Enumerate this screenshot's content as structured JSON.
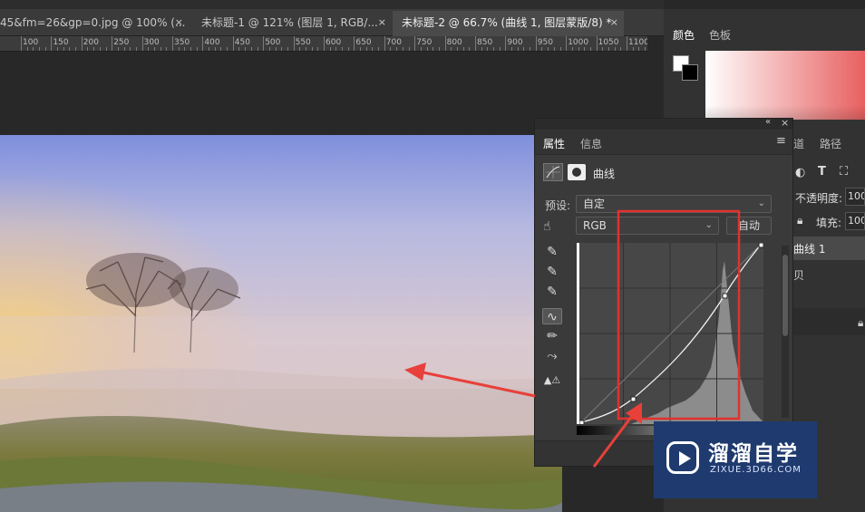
{
  "tabs": [
    {
      "label": "45&fm=26&gp=0.jpg @ 100% (...",
      "active": false
    },
    {
      "label": "未标题-1 @ 121% (图层 1, RGB/...",
      "active": false
    },
    {
      "label": "未标题-2 @ 66.7% (曲线 1, 图层蒙版/8) *",
      "active": true
    }
  ],
  "close_glyph": "×",
  "ruler": {
    "labels": [
      "100",
      "150",
      "200",
      "250",
      "300",
      "350",
      "400",
      "450",
      "500",
      "550",
      "600",
      "650",
      "700",
      "750",
      "800",
      "850",
      "900",
      "950",
      "1000",
      "1050",
      "1100"
    ]
  },
  "color_panel": {
    "tabs": [
      "颜色",
      "色板"
    ]
  },
  "layers_panel": {
    "tabs": [
      "道",
      "路径"
    ],
    "opacity_label": "不透明度:",
    "opacity_value": "100",
    "fill_label": "填充:",
    "fill_value": "100",
    "layer1_name": "曲线 1",
    "layer2_name": "贝"
  },
  "properties": {
    "tabs": [
      "属性",
      "信息"
    ],
    "panel_title": "曲线",
    "preset_label": "预设:",
    "preset_value": "自定",
    "channel_value": "RGB",
    "auto_label": "自动"
  },
  "watermark": {
    "title": "溜溜自学",
    "subtitle": "ZIXUE.3D66.COM"
  },
  "colors": {
    "highlight_rect": "#e0322e",
    "arrow": "#e8403a",
    "watermark_bg": "#1f3a6e"
  },
  "icons": [
    "close-icon",
    "eyedropper-black-icon",
    "eyedropper-gray-icon",
    "eyedropper-white-icon",
    "curve-point-icon",
    "pencil-icon",
    "smooth-icon",
    "clip-warning-icon",
    "hand-target-icon",
    "panel-menu-icon",
    "collapse-icon",
    "lock-icon",
    "text-icon",
    "transform-icon"
  ]
}
